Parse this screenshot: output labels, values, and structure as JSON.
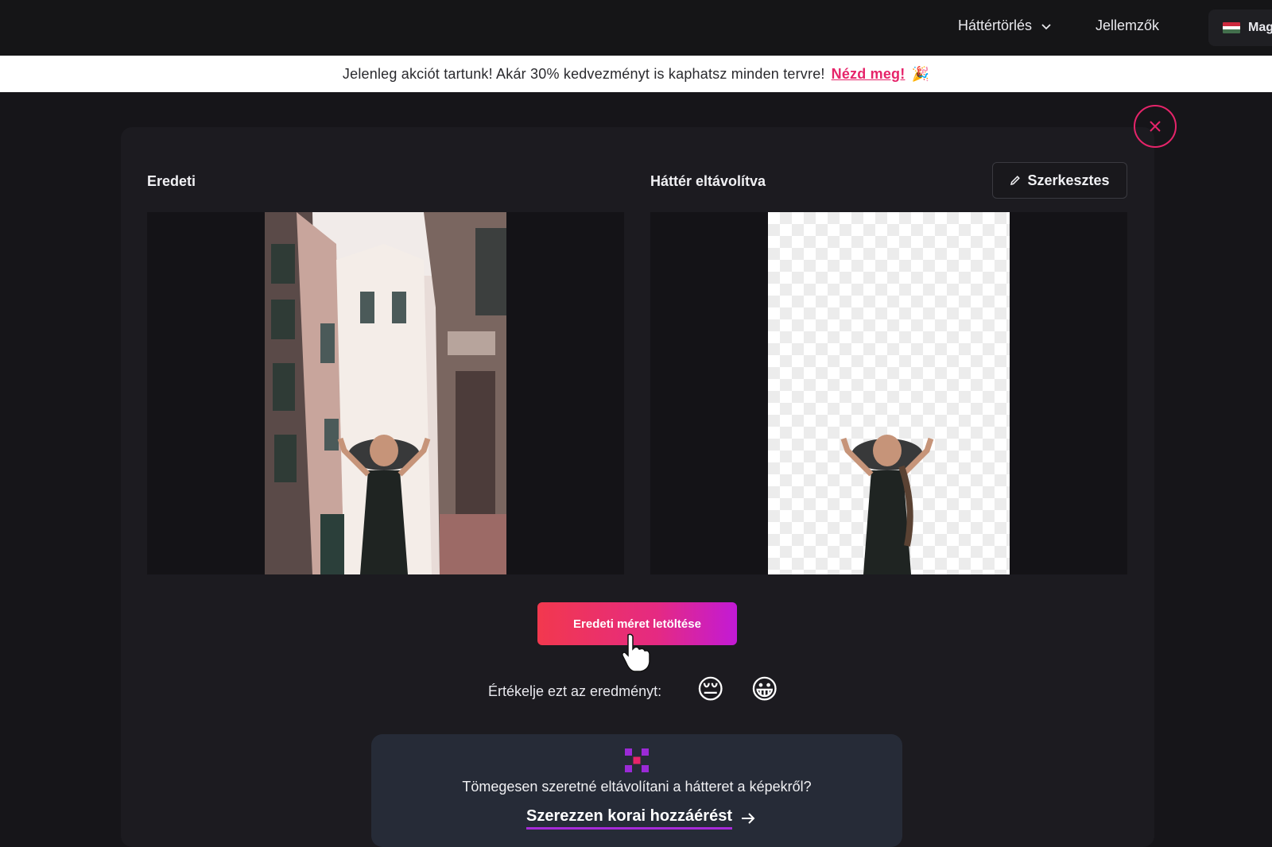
{
  "nav": {
    "background_removal": "Háttértörlés",
    "features": "Jellemzők",
    "language": "Mag"
  },
  "promo": {
    "text": "Jelenleg akciót tartunk! Akár 30% kedvezményt is kaphatsz minden tervre!",
    "link": "Nézd meg!",
    "emoji": "🎉"
  },
  "result": {
    "original_label": "Eredeti",
    "removed_label": "Háttér eltávolítva",
    "edit_button": "Szerkesztes",
    "download_button": "Eredeti méret letöltése"
  },
  "rating": {
    "prompt": "Értékelje ezt az eredményt:",
    "sad": "😔",
    "happy": "😀"
  },
  "bulk": {
    "question": "Tömegesen szeretné eltávolítani a hátteret a képekről?",
    "cta": "Szerezzen korai hozzáérést"
  },
  "colors": {
    "accent": "#e6246a",
    "gradient_start": "#f2384e",
    "gradient_end": "#c21ad6",
    "flag": [
      "#cd2a3e",
      "#ffffff",
      "#436f4d"
    ]
  }
}
